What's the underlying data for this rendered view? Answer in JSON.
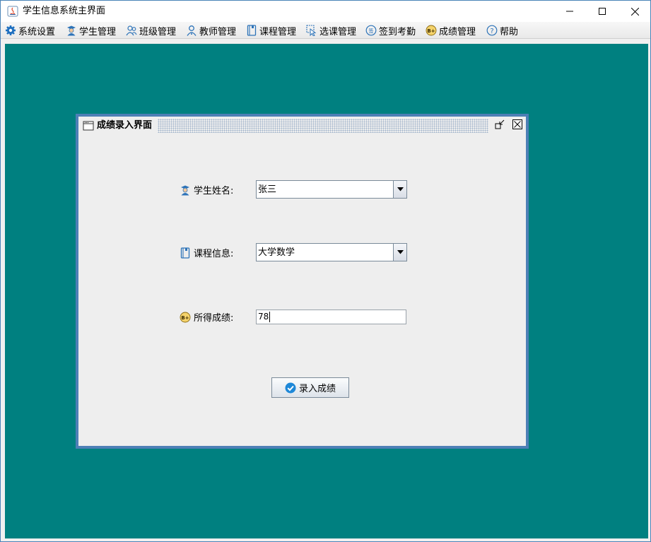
{
  "window": {
    "title": "学生信息系统主界面"
  },
  "menu": [
    {
      "label": "系统设置",
      "icon": "gear-icon"
    },
    {
      "label": "学生管理",
      "icon": "student-icon"
    },
    {
      "label": "班级管理",
      "icon": "class-icon"
    },
    {
      "label": "教师管理",
      "icon": "teacher-icon"
    },
    {
      "label": "课程管理",
      "icon": "course-icon"
    },
    {
      "label": "选课管理",
      "icon": "select-course-icon"
    },
    {
      "label": "签到考勤",
      "icon": "sign-in-icon"
    },
    {
      "label": "成绩管理",
      "icon": "grade-icon"
    },
    {
      "label": "帮助",
      "icon": "help-icon"
    }
  ],
  "frame": {
    "title": "成绩录入界面",
    "student_label": "学生姓名:",
    "student_value": "张三",
    "course_label": "课程信息:",
    "course_value": "大学数学",
    "score_label": "所得成绩:",
    "score_value": "78",
    "submit_label": "录入成绩"
  },
  "colors": {
    "desktop": "#008080",
    "frame_border": "#4d7fb6",
    "accent": "#1e88d8"
  }
}
